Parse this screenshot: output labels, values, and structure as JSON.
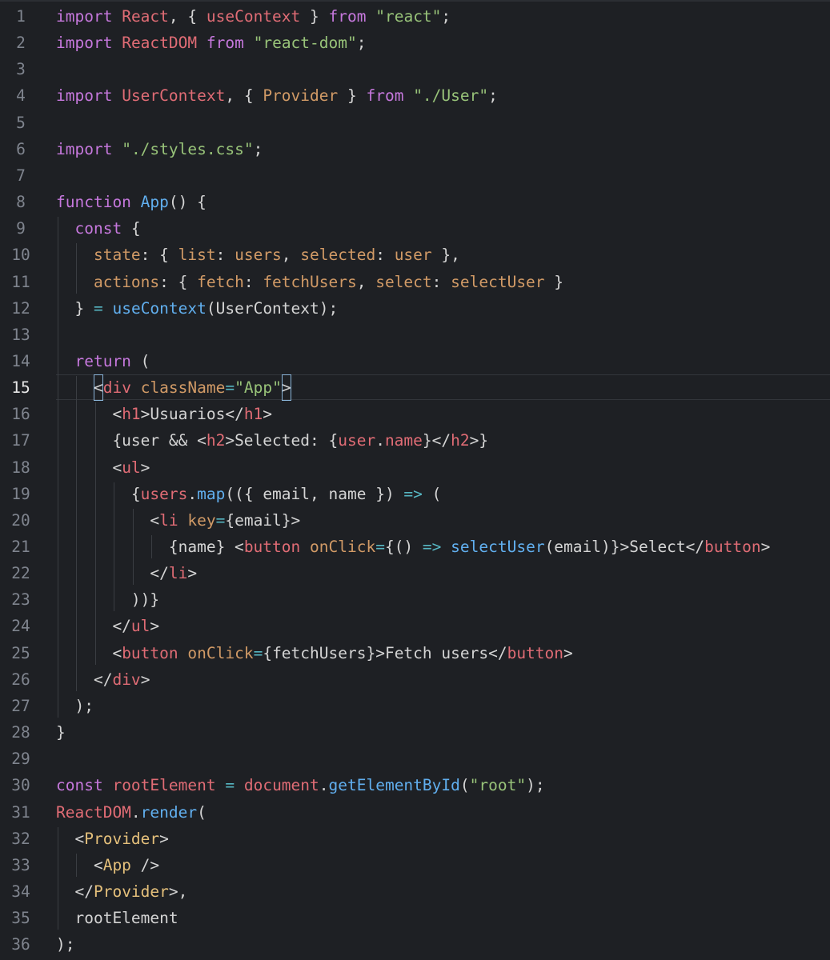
{
  "editor": {
    "current_line": 15,
    "colors": {
      "background": "#1e2024",
      "keyword": "#c678dd",
      "identifier": "#e5c07b",
      "variable": "#e06c75",
      "string": "#98c379",
      "function": "#61afef",
      "attribute": "#d19a66",
      "operator": "#56b6c2",
      "line_number": "#7f848e"
    },
    "lines": [
      {
        "n": "1",
        "tokens": [
          [
            "kw",
            "import"
          ],
          [
            "plain",
            " "
          ],
          [
            "var",
            "React"
          ],
          [
            "plain",
            ", { "
          ],
          [
            "var",
            "useContext"
          ],
          [
            "plain",
            " } "
          ],
          [
            "kw",
            "from"
          ],
          [
            "plain",
            " "
          ],
          [
            "str",
            "\"react\""
          ],
          [
            "plain",
            ";"
          ]
        ]
      },
      {
        "n": "2",
        "tokens": [
          [
            "kw",
            "import"
          ],
          [
            "plain",
            " "
          ],
          [
            "var",
            "ReactDOM"
          ],
          [
            "plain",
            " "
          ],
          [
            "kw",
            "from"
          ],
          [
            "plain",
            " "
          ],
          [
            "str",
            "\"react-dom\""
          ],
          [
            "plain",
            ";"
          ]
        ]
      },
      {
        "n": "3",
        "tokens": []
      },
      {
        "n": "4",
        "tokens": [
          [
            "kw",
            "import"
          ],
          [
            "plain",
            " "
          ],
          [
            "var",
            "UserContext"
          ],
          [
            "plain",
            ", { "
          ],
          [
            "attr",
            "Provider"
          ],
          [
            "plain",
            " } "
          ],
          [
            "kw",
            "from"
          ],
          [
            "plain",
            " "
          ],
          [
            "str",
            "\"./User\""
          ],
          [
            "plain",
            ";"
          ]
        ]
      },
      {
        "n": "5",
        "tokens": []
      },
      {
        "n": "6",
        "tokens": [
          [
            "kw",
            "import"
          ],
          [
            "plain",
            " "
          ],
          [
            "str",
            "\"./styles.css\""
          ],
          [
            "plain",
            ";"
          ]
        ]
      },
      {
        "n": "7",
        "tokens": []
      },
      {
        "n": "8",
        "tokens": [
          [
            "kw",
            "function"
          ],
          [
            "plain",
            " "
          ],
          [
            "fn",
            "App"
          ],
          [
            "plain",
            "() {"
          ]
        ]
      },
      {
        "n": "9",
        "tokens": [
          [
            "plain",
            "  "
          ],
          [
            "kw",
            "const"
          ],
          [
            "plain",
            " {"
          ]
        ]
      },
      {
        "n": "10",
        "tokens": [
          [
            "plain",
            "    "
          ],
          [
            "attr",
            "state"
          ],
          [
            "plain",
            ": { "
          ],
          [
            "attr",
            "list"
          ],
          [
            "plain",
            ": "
          ],
          [
            "attr",
            "users"
          ],
          [
            "plain",
            ", "
          ],
          [
            "attr",
            "selected"
          ],
          [
            "plain",
            ": "
          ],
          [
            "attr",
            "user"
          ],
          [
            "plain",
            " },"
          ]
        ]
      },
      {
        "n": "11",
        "tokens": [
          [
            "plain",
            "    "
          ],
          [
            "attr",
            "actions"
          ],
          [
            "plain",
            ": { "
          ],
          [
            "attr",
            "fetch"
          ],
          [
            "plain",
            ": "
          ],
          [
            "attr",
            "fetchUsers"
          ],
          [
            "plain",
            ", "
          ],
          [
            "attr",
            "select"
          ],
          [
            "plain",
            ": "
          ],
          [
            "attr",
            "selectUser"
          ],
          [
            "plain",
            " }"
          ]
        ]
      },
      {
        "n": "12",
        "tokens": [
          [
            "plain",
            "  } "
          ],
          [
            "op",
            "="
          ],
          [
            "plain",
            " "
          ],
          [
            "fn",
            "useContext"
          ],
          [
            "plain",
            "(UserContext);"
          ]
        ]
      },
      {
        "n": "13",
        "tokens": []
      },
      {
        "n": "14",
        "tokens": [
          [
            "plain",
            "  "
          ],
          [
            "kw",
            "return"
          ],
          [
            "plain",
            " ("
          ]
        ]
      },
      {
        "n": "15",
        "tokens": [
          [
            "plain",
            "    "
          ],
          [
            "cursor",
            "<"
          ],
          [
            "tag",
            "div"
          ],
          [
            "plain",
            " "
          ],
          [
            "attr",
            "className"
          ],
          [
            "op",
            "="
          ],
          [
            "str",
            "\"App\""
          ],
          [
            "cursor",
            ">"
          ]
        ]
      },
      {
        "n": "16",
        "tokens": [
          [
            "plain",
            "      <"
          ],
          [
            "tag",
            "h1"
          ],
          [
            "plain",
            ">Usuarios</"
          ],
          [
            "tag",
            "h1"
          ],
          [
            "plain",
            ">"
          ]
        ]
      },
      {
        "n": "17",
        "tokens": [
          [
            "plain",
            "      {user && <"
          ],
          [
            "tag",
            "h2"
          ],
          [
            "plain",
            ">Selected: {"
          ],
          [
            "var",
            "user"
          ],
          [
            "plain",
            "."
          ],
          [
            "var",
            "name"
          ],
          [
            "plain",
            "}</"
          ],
          [
            "tag",
            "h2"
          ],
          [
            "plain",
            ">}"
          ]
        ]
      },
      {
        "n": "18",
        "tokens": [
          [
            "plain",
            "      <"
          ],
          [
            "tag",
            "ul"
          ],
          [
            "plain",
            ">"
          ]
        ]
      },
      {
        "n": "19",
        "tokens": [
          [
            "plain",
            "        {"
          ],
          [
            "var",
            "users"
          ],
          [
            "plain",
            "."
          ],
          [
            "fn",
            "map"
          ],
          [
            "plain",
            "(({ email, name }) "
          ],
          [
            "op",
            "=>"
          ],
          [
            "plain",
            " ("
          ]
        ]
      },
      {
        "n": "20",
        "tokens": [
          [
            "plain",
            "          <"
          ],
          [
            "tag",
            "li"
          ],
          [
            "plain",
            " "
          ],
          [
            "attr",
            "key"
          ],
          [
            "op",
            "="
          ],
          [
            "plain",
            "{email}>"
          ]
        ]
      },
      {
        "n": "21",
        "tokens": [
          [
            "plain",
            "            {name} <"
          ],
          [
            "tag",
            "button"
          ],
          [
            "plain",
            " "
          ],
          [
            "attr",
            "onClick"
          ],
          [
            "op",
            "="
          ],
          [
            "plain",
            "{() "
          ],
          [
            "op",
            "=>"
          ],
          [
            "plain",
            " "
          ],
          [
            "fn",
            "selectUser"
          ],
          [
            "plain",
            "(email)}>Select</"
          ],
          [
            "tag",
            "button"
          ],
          [
            "plain",
            ">"
          ]
        ]
      },
      {
        "n": "22",
        "tokens": [
          [
            "plain",
            "          </"
          ],
          [
            "tag",
            "li"
          ],
          [
            "plain",
            ">"
          ]
        ]
      },
      {
        "n": "23",
        "tokens": [
          [
            "plain",
            "        ))}"
          ]
        ]
      },
      {
        "n": "24",
        "tokens": [
          [
            "plain",
            "      </"
          ],
          [
            "tag",
            "ul"
          ],
          [
            "plain",
            ">"
          ]
        ]
      },
      {
        "n": "25",
        "tokens": [
          [
            "plain",
            "      <"
          ],
          [
            "tag",
            "button"
          ],
          [
            "plain",
            " "
          ],
          [
            "attr",
            "onClick"
          ],
          [
            "op",
            "="
          ],
          [
            "plain",
            "{fetchUsers}>Fetch users</"
          ],
          [
            "tag",
            "button"
          ],
          [
            "plain",
            ">"
          ]
        ]
      },
      {
        "n": "26",
        "tokens": [
          [
            "plain",
            "    </"
          ],
          [
            "tag",
            "div"
          ],
          [
            "plain",
            ">"
          ]
        ]
      },
      {
        "n": "27",
        "tokens": [
          [
            "plain",
            "  );"
          ]
        ]
      },
      {
        "n": "28",
        "tokens": [
          [
            "plain",
            "}"
          ]
        ]
      },
      {
        "n": "29",
        "tokens": []
      },
      {
        "n": "30",
        "tokens": [
          [
            "kw",
            "const"
          ],
          [
            "plain",
            " "
          ],
          [
            "var",
            "rootElement"
          ],
          [
            "plain",
            " "
          ],
          [
            "op",
            "="
          ],
          [
            "plain",
            " "
          ],
          [
            "var",
            "document"
          ],
          [
            "plain",
            "."
          ],
          [
            "fn",
            "getElementById"
          ],
          [
            "plain",
            "("
          ],
          [
            "str",
            "\"root\""
          ],
          [
            "plain",
            ");"
          ]
        ]
      },
      {
        "n": "31",
        "tokens": [
          [
            "var",
            "ReactDOM"
          ],
          [
            "plain",
            "."
          ],
          [
            "fn",
            "render"
          ],
          [
            "plain",
            "("
          ]
        ]
      },
      {
        "n": "32",
        "tokens": [
          [
            "plain",
            "  <"
          ],
          [
            "id",
            "Provider"
          ],
          [
            "plain",
            ">"
          ]
        ]
      },
      {
        "n": "33",
        "tokens": [
          [
            "plain",
            "    <"
          ],
          [
            "id",
            "App"
          ],
          [
            "plain",
            " />"
          ]
        ]
      },
      {
        "n": "34",
        "tokens": [
          [
            "plain",
            "  </"
          ],
          [
            "id",
            "Provider"
          ],
          [
            "plain",
            ">,"
          ]
        ]
      },
      {
        "n": "35",
        "tokens": [
          [
            "plain",
            "  rootElement"
          ]
        ]
      },
      {
        "n": "36",
        "tokens": [
          [
            "plain",
            ");"
          ]
        ]
      }
    ]
  }
}
